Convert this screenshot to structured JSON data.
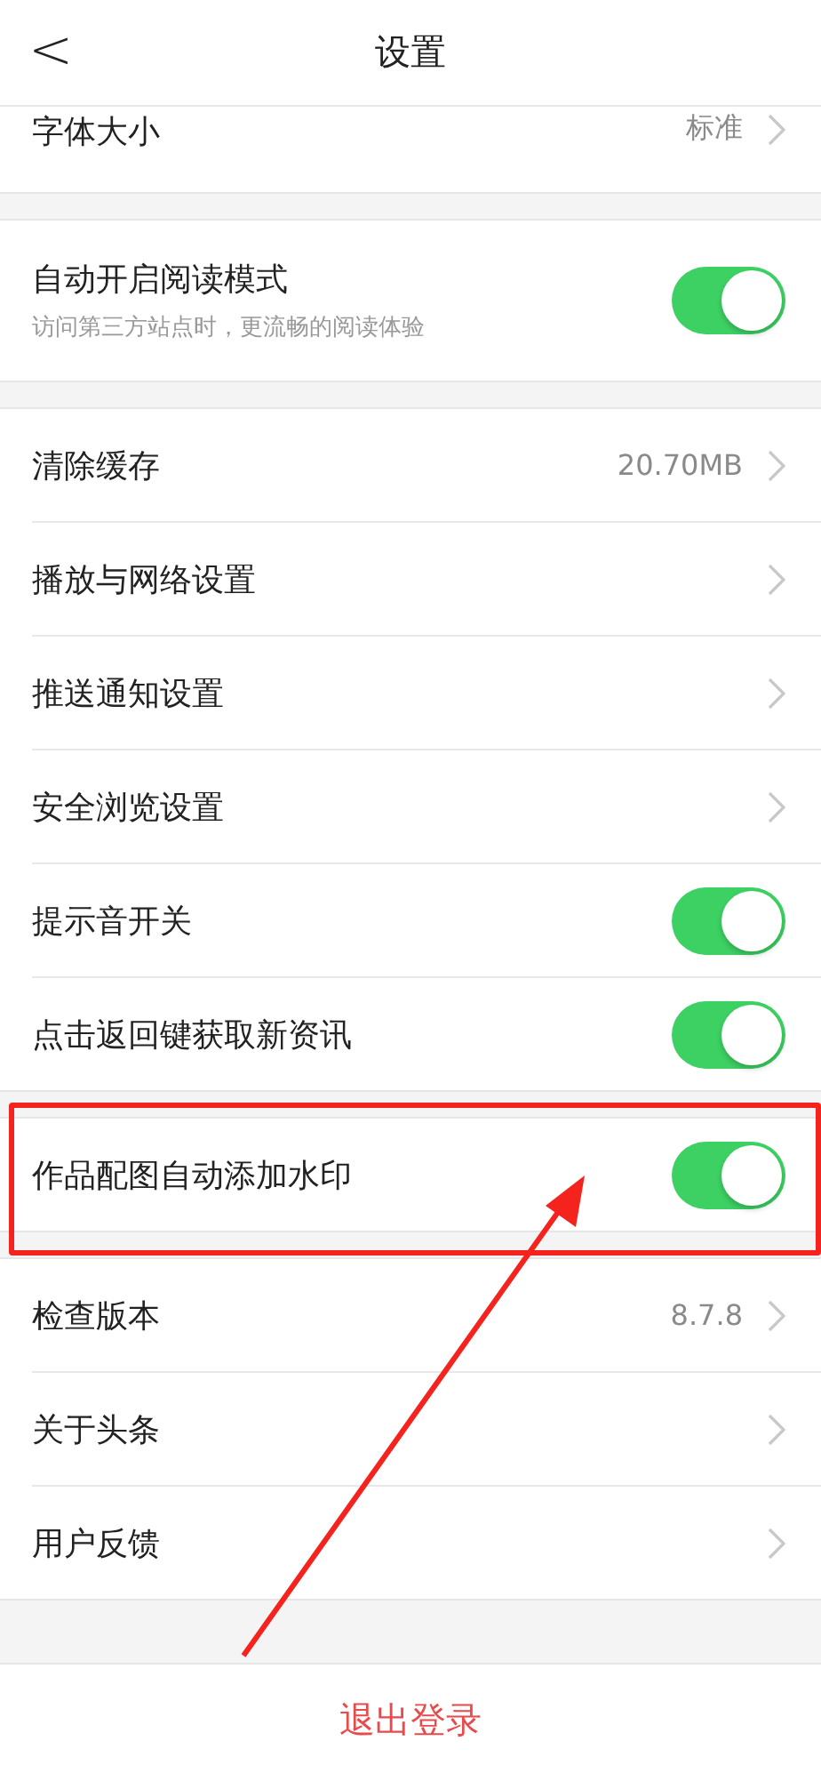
{
  "header": {
    "back": "<",
    "title": "设置"
  },
  "groups": [
    {
      "rows": [
        {
          "kind": "link",
          "label": "字体大小",
          "value": "标准"
        }
      ]
    },
    {
      "rows": [
        {
          "kind": "toggle",
          "label": "自动开启阅读模式",
          "subtitle": "访问第三方站点时，更流畅的阅读体验",
          "on": true
        }
      ]
    },
    {
      "rows": [
        {
          "kind": "link",
          "label": "清除缓存",
          "value": "20.70MB"
        },
        {
          "kind": "link",
          "label": "播放与网络设置"
        },
        {
          "kind": "link",
          "label": "推送通知设置"
        },
        {
          "kind": "link",
          "label": "安全浏览设置"
        },
        {
          "kind": "toggle",
          "label": "提示音开关",
          "on": true
        },
        {
          "kind": "toggle",
          "label": "点击返回键获取新资讯",
          "on": true
        }
      ]
    },
    {
      "rows": [
        {
          "kind": "toggle",
          "label": "作品配图自动添加水印",
          "on": true
        }
      ]
    },
    {
      "rows": [
        {
          "kind": "link",
          "label": "检查版本",
          "value": "8.7.8"
        },
        {
          "kind": "link",
          "label": "关于头条"
        },
        {
          "kind": "link",
          "label": "用户反馈"
        }
      ]
    }
  ],
  "logout": "退出登录"
}
